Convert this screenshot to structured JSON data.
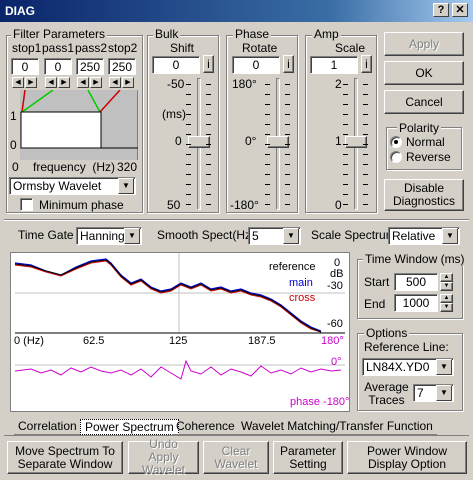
{
  "window": {
    "title": "DIAG",
    "help_label": "?",
    "close_label": "X"
  },
  "filter": {
    "title": "Filter Parameters",
    "headers": [
      "stop1",
      "pass1",
      "pass2",
      "stop2"
    ],
    "values": [
      "0",
      "0",
      "250",
      "250"
    ],
    "ylabel_top": "1",
    "ylabel_bottom": "0",
    "freq_left": "0",
    "freq_right": "320",
    "freq_label": "frequency  (Hz)",
    "wavelet_value": "Ormsby Wavelet",
    "min_phase_label": "Minimum phase",
    "min_phase_checked": false
  },
  "bulk": {
    "title": "Bulk",
    "subtitle": "Shift",
    "value": "0",
    "i_label": "i",
    "ticks": [
      "-50",
      "(ms)",
      "0",
      "50"
    ],
    "level": 0
  },
  "phase": {
    "title": "Phase",
    "subtitle": "Rotate",
    "value": "0",
    "i_label": "i",
    "ticks": [
      "180°",
      "0°",
      "-180°"
    ],
    "level": 0
  },
  "amp": {
    "title": "Amp",
    "subtitle": "Scale",
    "value": "1",
    "i_label": "i",
    "ticks": [
      "2",
      "1",
      "0"
    ],
    "level": 1
  },
  "side": {
    "apply": "Apply",
    "ok": "OK",
    "cancel": "Cancel",
    "polarity_title": "Polarity",
    "normal": "Normal",
    "reverse": "Reverse",
    "polarity_selected": "Normal",
    "disable_diag": "Disable Diagnostics"
  },
  "controls": {
    "time_gate_label": "Time Gate",
    "time_gate_value": "Hanning",
    "smooth_label": "Smooth Spect(Hz)",
    "smooth_value": "5",
    "scale_label": "Scale Spectrum",
    "scale_value": "Relative"
  },
  "plot": {
    "legend_reference": "reference",
    "legend_main": "main",
    "legend_cross": "cross",
    "db_0": "0",
    "db_unit": "dB",
    "db_30": "-30",
    "db_60": "-60",
    "x_ticks": [
      "0 (Hz)",
      "62.5",
      "125",
      "187.5",
      "180°"
    ],
    "phase_0": "0°",
    "phase_bottom": "phase -180°",
    "colors": {
      "reference": "#000000",
      "main": "#0000cc",
      "cross": "#cc0000",
      "phase": "#cc00cc",
      "axis_label": "#cc00cc"
    }
  },
  "time_window": {
    "title": "Time Window (ms)",
    "start_label": "Start",
    "start_value": "500",
    "end_label": "End",
    "end_value": "1000"
  },
  "options": {
    "title": "Options",
    "ref_line_label": "Reference Line:",
    "ref_line_value": "LN84X.YD0",
    "avg_label": "Average Traces",
    "avg_value": "7"
  },
  "tabs": [
    "Correlation",
    "Power Spectrum",
    "Coherence",
    "Wavelet Matching/Transfer Function"
  ],
  "active_tab": "Power Spectrum",
  "bottom": {
    "move": "Move Spectrum To Separate Window",
    "undo": "Undo Apply Wavelet",
    "clear": "Clear Wavelet",
    "param": "Parameter Setting",
    "power": "Power Window Display Option"
  }
}
